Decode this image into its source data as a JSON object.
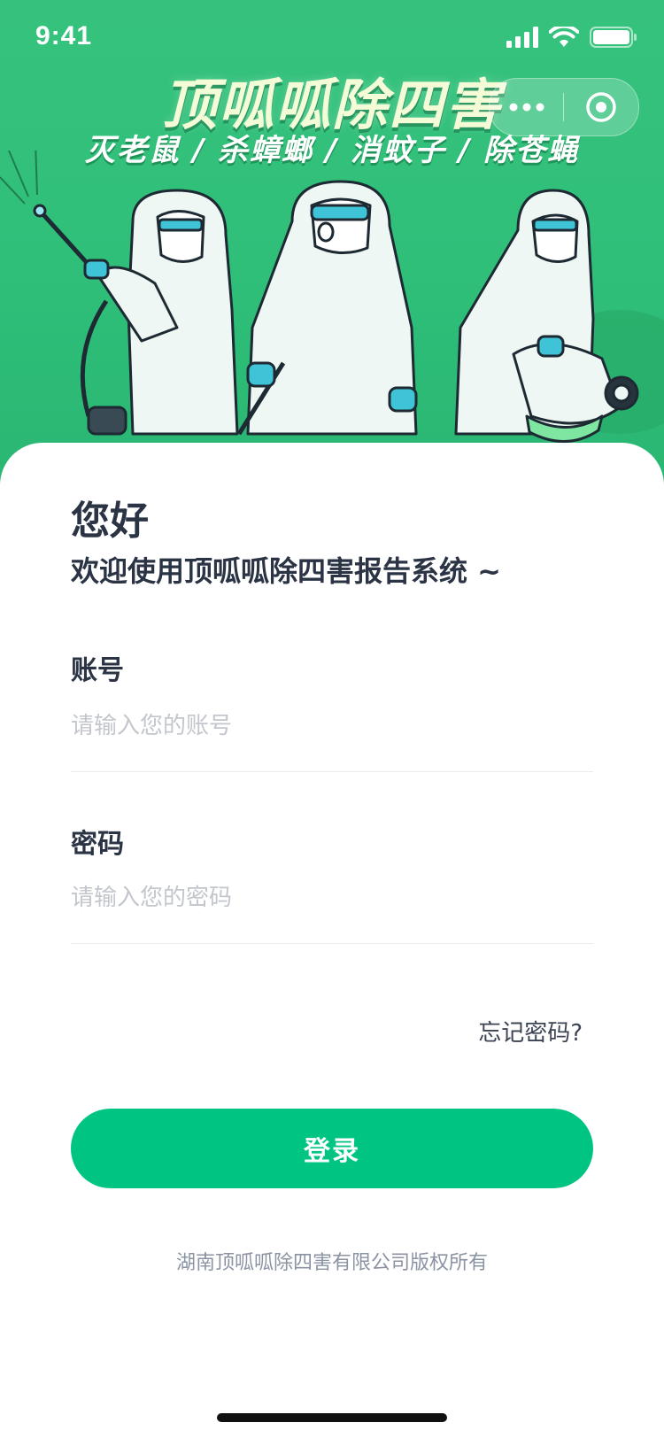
{
  "status_bar": {
    "time": "9:41"
  },
  "hero": {
    "title": "顶呱呱除四害",
    "subtitle": "灭老鼠 / 杀蟑螂 / 消蚊子 / 除苍蝇",
    "bg_color": "#36c27d"
  },
  "capsule": {
    "more_icon": "more-dots-icon",
    "close_icon": "target-circle-icon"
  },
  "greeting": {
    "title": "您好",
    "subtitle": "欢迎使用顶呱呱除四害报告系统 ~"
  },
  "form": {
    "account": {
      "label": "账号",
      "placeholder": "请输入您的账号",
      "value": ""
    },
    "password": {
      "label": "密码",
      "placeholder": "请输入您的密码",
      "value": ""
    },
    "forgot_label": "忘记密码?",
    "login_label": "登录"
  },
  "footer": {
    "copyright": "湖南顶呱呱除四害有限公司版权所有"
  },
  "colors": {
    "accent": "#00c582",
    "text": "#2b3445",
    "placeholder": "#c3c6cc"
  }
}
